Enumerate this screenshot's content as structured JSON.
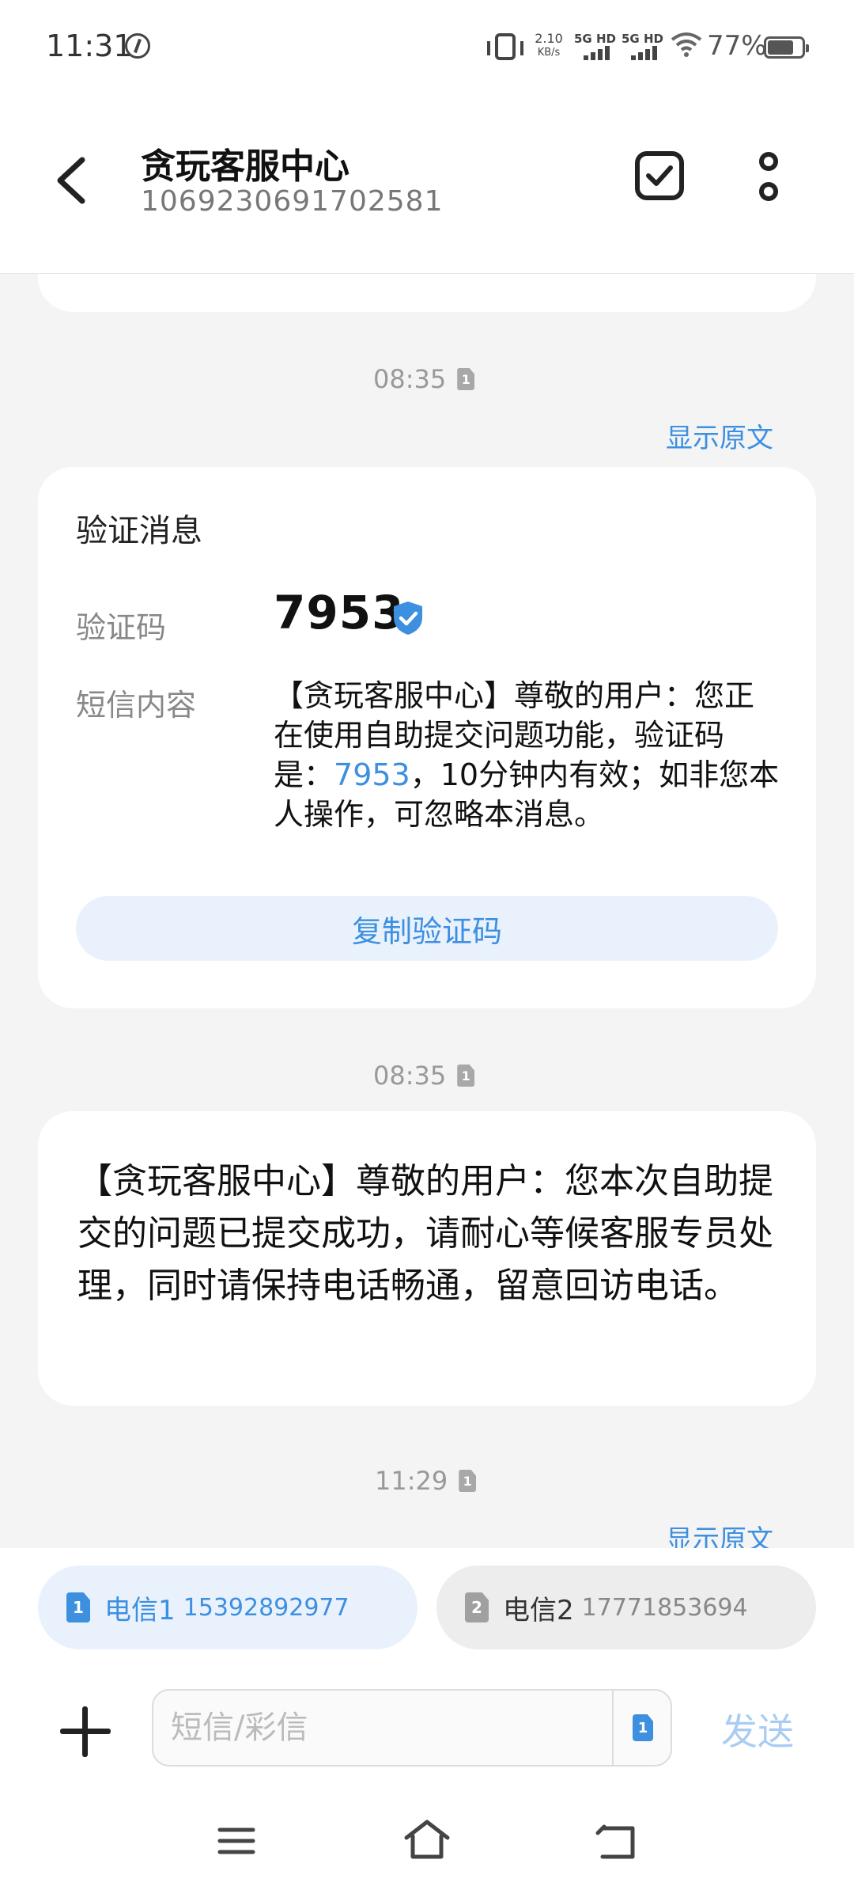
{
  "status_bar": {
    "time": "11:31",
    "speed_value": "2.10",
    "speed_unit": "KB/s",
    "net1_label": "5G HD",
    "net2_label": "5G HD",
    "battery_percent": "77%",
    "battery_level": 0.77
  },
  "header": {
    "contact_name": "贪玩客服中心",
    "contact_number": "1069230691702581"
  },
  "conversation": {
    "messages": [
      {
        "time": "08:35",
        "sim": "1",
        "show_original": "显示原文",
        "card_title": "验证消息",
        "code_label": "验证码",
        "code": "7953",
        "content_label": "短信内容",
        "content_before": "【贪玩客服中心】尊敬的用户：您正在使用自助提交问题功能，验证码是：",
        "content_code": "7953",
        "content_after": "，10分钟内有效；如非您本人操作，可忽略本消息。",
        "copy_button": "复制验证码"
      },
      {
        "time": "08:35",
        "sim": "1",
        "text": "【贪玩客服中心】尊敬的用户：您本次自助提交的问题已提交成功，请耐心等候客服专员处理，同时请保持电话畅通，留意回访电话。"
      },
      {
        "time": "11:29",
        "sim": "1",
        "show_original": "显示原文"
      }
    ]
  },
  "sim_selector": {
    "sim1": {
      "index": "1",
      "name": "电信1",
      "number": "15392892977",
      "selected": true
    },
    "sim2": {
      "index": "2",
      "name": "电信2",
      "number": "17771853694",
      "selected": false
    }
  },
  "input_bar": {
    "placeholder": "短信/彩信",
    "sim_index": "1",
    "send_label": "发送"
  },
  "colors": {
    "accent": "#3d8fe0",
    "background": "#f4f4f4",
    "card": "#ffffff",
    "send_disabled": "#a9cdf2"
  }
}
